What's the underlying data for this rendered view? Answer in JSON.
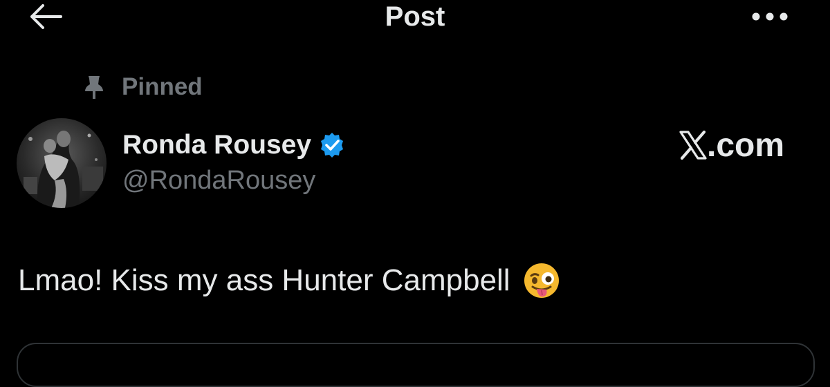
{
  "header": {
    "title": "Post",
    "back_icon": "arrow-left-icon",
    "more_icon": "more-horizontal-icon"
  },
  "pinned": {
    "label": "Pinned",
    "icon": "pin-icon"
  },
  "author": {
    "display_name": "Ronda Rousey",
    "handle": "@RondaRousey",
    "verified": true,
    "verified_color": "#1d9bf0"
  },
  "watermark": {
    "text": ".com",
    "logo": "x-logo-icon"
  },
  "post": {
    "text": "Lmao! Kiss my ass Hunter Campbell",
    "emoji": "winking-face-with-tongue-icon"
  },
  "colors": {
    "background": "#000000",
    "primary_text": "#e7e9ea",
    "secondary_text": "#71767b",
    "accent": "#1d9bf0"
  }
}
